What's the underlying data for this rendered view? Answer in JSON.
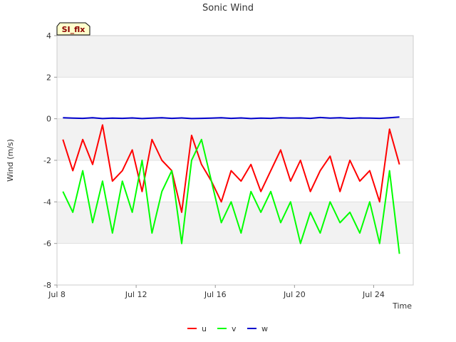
{
  "chart_data": {
    "type": "line",
    "title": "Sonic Wind",
    "xlabel": "Time",
    "ylabel": "Wind (m/s)",
    "badge": "SI_flx",
    "x_ticks": [
      "Jul 8",
      "Jul 12",
      "Jul 16",
      "Jul 20",
      "Jul 24"
    ],
    "x_tick_days": [
      0,
      4,
      8,
      12,
      16
    ],
    "xlim_days": [
      0,
      18
    ],
    "ylim": [
      -8,
      4
    ],
    "y_ticks": [
      4,
      2,
      0,
      -2,
      -4,
      -6,
      -8
    ],
    "grid": "horizontal bands",
    "legend_position": "bottom-center",
    "x_days": [
      0.3,
      0.8,
      1.3,
      1.8,
      2.3,
      2.8,
      3.3,
      3.8,
      4.3,
      4.8,
      5.3,
      5.8,
      6.3,
      6.8,
      7.3,
      7.8,
      8.3,
      8.8,
      9.3,
      9.8,
      10.3,
      10.8,
      11.3,
      11.8,
      12.3,
      12.8,
      13.3,
      13.8,
      14.3,
      14.8,
      15.3,
      15.8,
      16.3,
      16.8,
      17.3
    ],
    "series": [
      {
        "name": "u",
        "color": "#ff0000",
        "values": [
          -1.0,
          -2.5,
          -1.0,
          -2.2,
          -0.3,
          -3.0,
          -2.5,
          -1.5,
          -3.5,
          -1.0,
          -2.0,
          -2.5,
          -4.5,
          -0.8,
          -2.2,
          -3.0,
          -4.0,
          -2.5,
          -3.0,
          -2.2,
          -3.5,
          -2.5,
          -1.5,
          -3.0,
          -2.0,
          -3.5,
          -2.5,
          -1.8,
          -3.5,
          -2.0,
          -3.0,
          -2.5,
          -4.0,
          -0.5,
          -2.2
        ]
      },
      {
        "name": "v",
        "color": "#00ff00",
        "values": [
          -3.5,
          -4.5,
          -2.5,
          -5.0,
          -3.0,
          -5.5,
          -3.0,
          -4.5,
          -2.0,
          -5.5,
          -3.5,
          -2.5,
          -6.0,
          -2.0,
          -1.0,
          -3.0,
          -5.0,
          -4.0,
          -5.5,
          -3.5,
          -4.5,
          -3.5,
          -5.0,
          -4.0,
          -6.0,
          -4.5,
          -5.5,
          -4.0,
          -5.0,
          -4.5,
          -5.5,
          -4.0,
          -6.0,
          -2.5,
          -6.5
        ]
      },
      {
        "name": "w",
        "color": "#0000cc",
        "values": [
          0.05,
          0.03,
          0.02,
          0.05,
          0.01,
          0.03,
          0.02,
          0.04,
          0.01,
          0.03,
          0.05,
          0.02,
          0.04,
          0.01,
          0.02,
          0.03,
          0.05,
          0.02,
          0.04,
          0.01,
          0.03,
          0.02,
          0.05,
          0.03,
          0.04,
          0.02,
          0.06,
          0.03,
          0.05,
          0.02,
          0.04,
          0.03,
          0.02,
          0.05,
          0.08
        ]
      }
    ]
  }
}
